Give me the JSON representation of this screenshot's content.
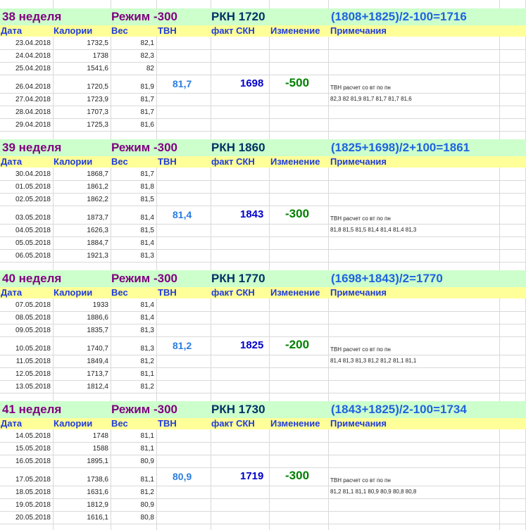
{
  "column_headers": {
    "date": "Дата",
    "calories": "Калории",
    "weight": "Вес",
    "tvn": "ТВН",
    "fact_skn": "факт СКН",
    "change": "Изменение",
    "notes": "Примечания"
  },
  "weeks": [
    {
      "week_label": "38  неделя",
      "mode_label": "Режим -300",
      "rkn_label": "РКН 1720",
      "formula": "(1808+1825)/2-100=1716",
      "rows": [
        {
          "date": "23.04.2018",
          "calories": "1732,5",
          "weight": "82,1"
        },
        {
          "date": "24.04.2018",
          "calories": "1738",
          "weight": "82,3"
        },
        {
          "date": "25.04.2018",
          "calories": "1541,6",
          "weight": "82"
        },
        {
          "date": "26.04.2018",
          "calories": "1720,5",
          "weight": "81,9"
        },
        {
          "date": "27.04.2018",
          "calories": "1723,9",
          "weight": "81,7"
        },
        {
          "date": "28.04.2018",
          "calories": "1707,3",
          "weight": "81,7"
        },
        {
          "date": "29.04.2018",
          "calories": "1725,3",
          "weight": "81,6"
        }
      ],
      "tvn": "81,7",
      "fact_skn": "1698",
      "change": "-500",
      "note_title": "ТВН расчет со вт по пн",
      "note_values": "82,3  82  81,9  81,7  81,7  81,7  81,6"
    },
    {
      "week_label": "39  неделя",
      "mode_label": "Режим -300",
      "rkn_label": "РКН 1860",
      "formula": "(1825+1698)/2+100=1861",
      "rows": [
        {
          "date": "30.04.2018",
          "calories": "1868,7",
          "weight": "81,7"
        },
        {
          "date": "01.05.2018",
          "calories": "1861,2",
          "weight": "81,8"
        },
        {
          "date": "02.05.2018",
          "calories": "1862,2",
          "weight": "81,5"
        },
        {
          "date": "03.05.2018",
          "calories": "1873,7",
          "weight": "81,4"
        },
        {
          "date": "04.05.2018",
          "calories": "1626,3",
          "weight": "81,5"
        },
        {
          "date": "05.05.2018",
          "calories": "1884,7",
          "weight": "81,4"
        },
        {
          "date": "06.05.2018",
          "calories": "1921,3",
          "weight": "81,3"
        }
      ],
      "tvn": "81,4",
      "fact_skn": "1843",
      "change": "-300",
      "note_title": "ТВН расчет со вт по пн",
      "note_values": "81,8  81,5  81,5  81,4  81,4  81,4  81,3"
    },
    {
      "week_label": "40  неделя",
      "mode_label": "Режим -300",
      "rkn_label": "РКН 1770",
      "formula": "(1698+1843)/2=1770",
      "rows": [
        {
          "date": "07.05.2018",
          "calories": "1933",
          "weight": "81,4"
        },
        {
          "date": "08.05.2018",
          "calories": "1886,6",
          "weight": "81,4"
        },
        {
          "date": "09.05.2018",
          "calories": "1835,7",
          "weight": "81,3"
        },
        {
          "date": "10.05.2018",
          "calories": "1740,7",
          "weight": "81,3"
        },
        {
          "date": "11.05.2018",
          "calories": "1849,4",
          "weight": "81,2"
        },
        {
          "date": "12.05.2018",
          "calories": "1713,7",
          "weight": "81,1"
        },
        {
          "date": "13.05.2018",
          "calories": "1812,4",
          "weight": "81,2"
        }
      ],
      "tvn": "81,2",
      "fact_skn": "1825",
      "change": "-200",
      "note_title": "ТВН расчет со вт по пн",
      "note_values": "81,4  81,3  81,3  81,2  81,2  81,1  81,1"
    },
    {
      "week_label": "41  неделя",
      "mode_label": "Режим -300",
      "rkn_label": "РКН 1730",
      "formula": "(1843+1825)/2-100=1734",
      "rows": [
        {
          "date": "14.05.2018",
          "calories": "1748",
          "weight": "81,1"
        },
        {
          "date": "15.05.2018",
          "calories": "1588",
          "weight": "81,1"
        },
        {
          "date": "16.05.2018",
          "calories": "1895,1",
          "weight": "80,9"
        },
        {
          "date": "17.05.2018",
          "calories": "1738,6",
          "weight": "81,1"
        },
        {
          "date": "18.05.2018",
          "calories": "1631,6",
          "weight": "81,2"
        },
        {
          "date": "19.05.2018",
          "calories": "1812,9",
          "weight": "80,9"
        },
        {
          "date": "20.05.2018",
          "calories": "1616,1",
          "weight": "80,8"
        }
      ],
      "tvn": "80,9",
      "fact_skn": "1719",
      "change": "-300",
      "note_title": "ТВН расчет со вт по пн",
      "note_values": "81,2  81,1  81,1  80,9  80,9  80,8  80,8"
    }
  ],
  "colors": {
    "header_band": "#ccffcc",
    "column_header_band": "#ffff99",
    "week_text": "#800080",
    "rkn_text": "#003366",
    "formula_text": "#1f63e0",
    "column_header_text": "#1f3bdc",
    "tvn_text": "#2b7de0",
    "fact_skn_text": "#0000cc",
    "change_text": "#008000"
  }
}
